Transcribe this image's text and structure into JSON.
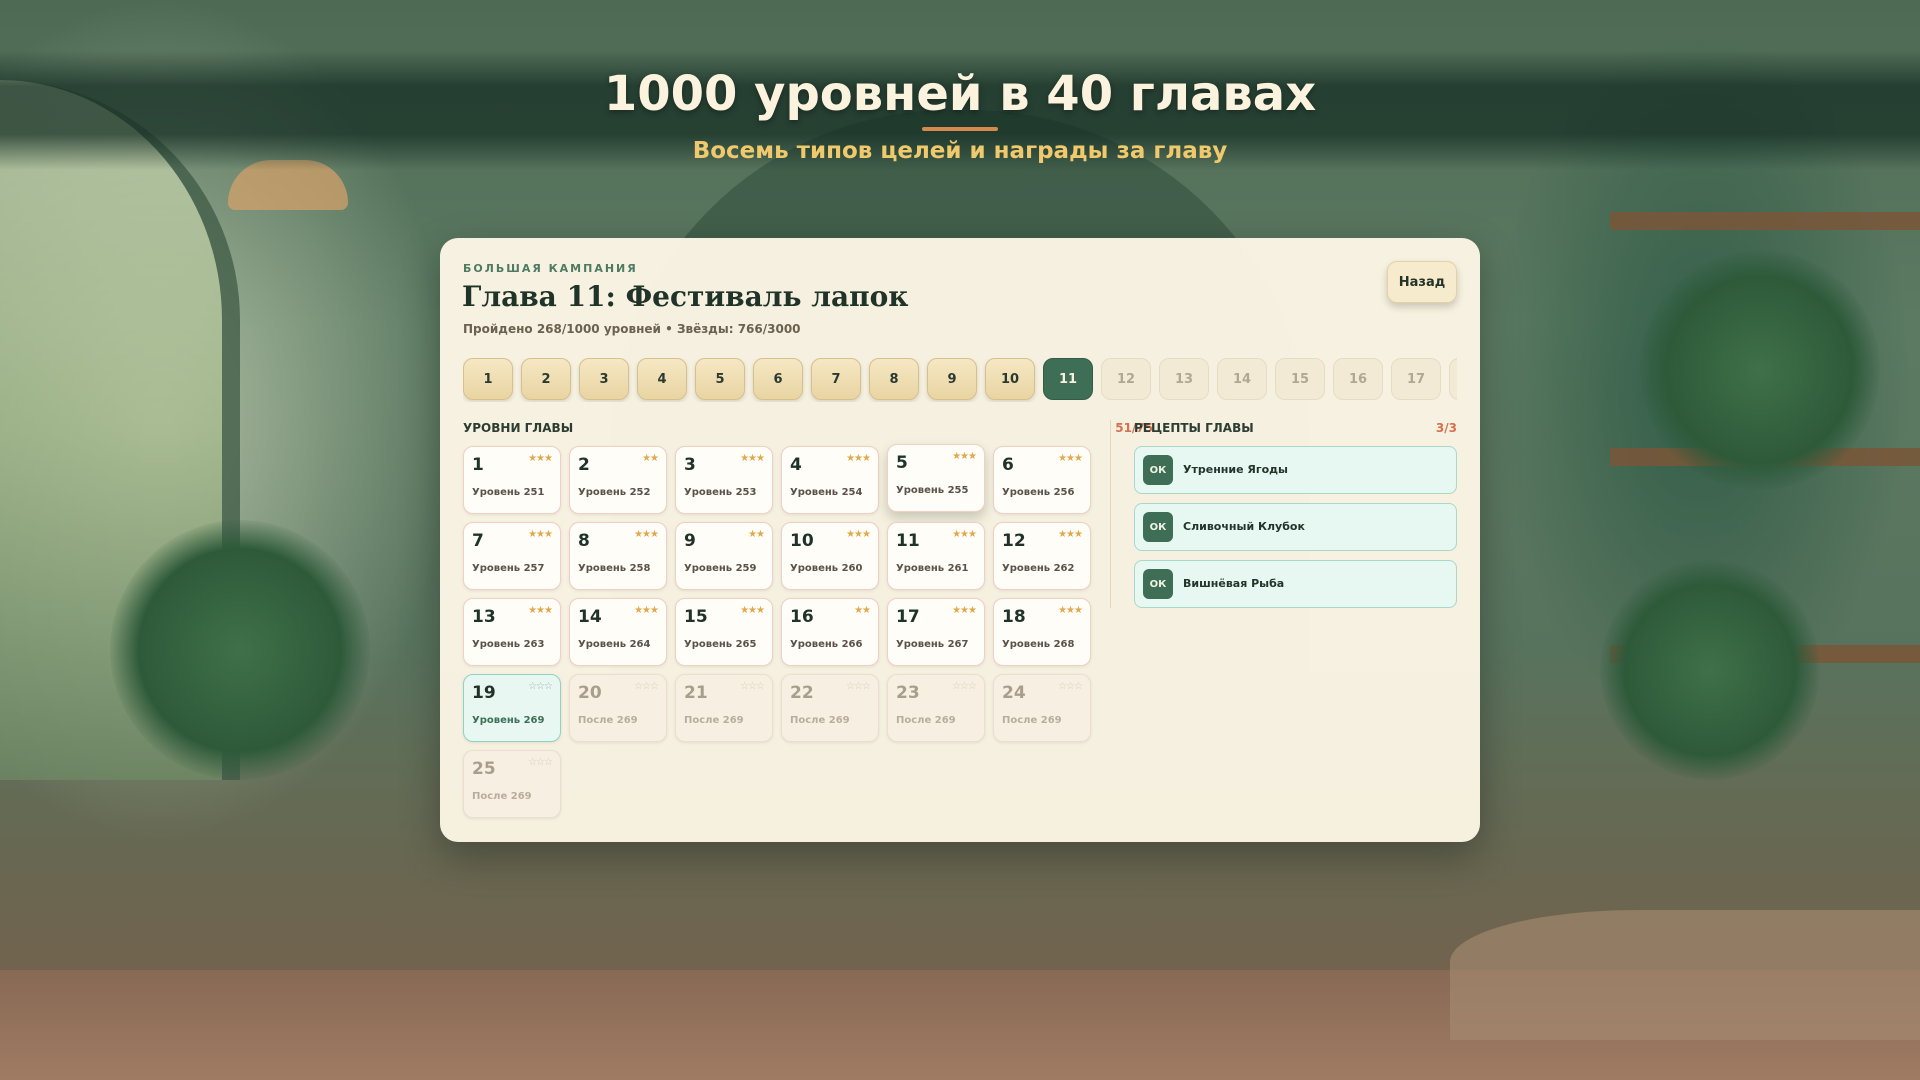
{
  "hero": {
    "title": "1000 уровней в 40 главах",
    "subtitle": "Восемь типов целей и награды за главу"
  },
  "panel": {
    "eyebrow": "БОЛЬШАЯ КАМПАНИЯ",
    "title": "Глава 11: Фестиваль лапок",
    "progress": "Пройдено 268/1000 уровней • Звёзды: 766/3000",
    "back_label": "Назад"
  },
  "chapters": {
    "visible": [
      {
        "label": "1",
        "state": "done"
      },
      {
        "label": "2",
        "state": "done"
      },
      {
        "label": "3",
        "state": "done"
      },
      {
        "label": "4",
        "state": "done"
      },
      {
        "label": "5",
        "state": "done"
      },
      {
        "label": "6",
        "state": "done"
      },
      {
        "label": "7",
        "state": "done"
      },
      {
        "label": "8",
        "state": "done"
      },
      {
        "label": "9",
        "state": "done"
      },
      {
        "label": "10",
        "state": "done"
      },
      {
        "label": "11",
        "state": "current"
      },
      {
        "label": "12",
        "state": "locked"
      },
      {
        "label": "13",
        "state": "locked"
      },
      {
        "label": "14",
        "state": "locked"
      },
      {
        "label": "15",
        "state": "locked"
      },
      {
        "label": "16",
        "state": "locked"
      },
      {
        "label": "17",
        "state": "locked"
      },
      {
        "label": "",
        "state": "locked"
      }
    ]
  },
  "levels": {
    "heading": "УРОВНИ ГЛАВЫ",
    "count": "51/75",
    "items": [
      {
        "num": "1",
        "sub": "Уровень 251",
        "stars": "★★★",
        "state": "done"
      },
      {
        "num": "2",
        "sub": "Уровень 252",
        "stars": "★★",
        "state": "done"
      },
      {
        "num": "3",
        "sub": "Уровень 253",
        "stars": "★★★",
        "state": "done"
      },
      {
        "num": "4",
        "sub": "Уровень 254",
        "stars": "★★★",
        "state": "done"
      },
      {
        "num": "5",
        "sub": "Уровень 255",
        "stars": "★★★",
        "state": "hover"
      },
      {
        "num": "6",
        "sub": "Уровень 256",
        "stars": "★★★",
        "state": "done"
      },
      {
        "num": "7",
        "sub": "Уровень 257",
        "stars": "★★★",
        "state": "done"
      },
      {
        "num": "8",
        "sub": "Уровень 258",
        "stars": "★★★",
        "state": "done"
      },
      {
        "num": "9",
        "sub": "Уровень 259",
        "stars": "★★",
        "state": "done"
      },
      {
        "num": "10",
        "sub": "Уровень 260",
        "stars": "★★★",
        "state": "done"
      },
      {
        "num": "11",
        "sub": "Уровень 261",
        "stars": "★★★",
        "state": "done"
      },
      {
        "num": "12",
        "sub": "Уровень 262",
        "stars": "★★★",
        "state": "done"
      },
      {
        "num": "13",
        "sub": "Уровень 263",
        "stars": "★★★",
        "state": "done"
      },
      {
        "num": "14",
        "sub": "Уровень 264",
        "stars": "★★★",
        "state": "done"
      },
      {
        "num": "15",
        "sub": "Уровень 265",
        "stars": "★★★",
        "state": "done"
      },
      {
        "num": "16",
        "sub": "Уровень 266",
        "stars": "★★",
        "state": "done"
      },
      {
        "num": "17",
        "sub": "Уровень 267",
        "stars": "★★★",
        "state": "done"
      },
      {
        "num": "18",
        "sub": "Уровень 268",
        "stars": "★★★",
        "state": "done"
      },
      {
        "num": "19",
        "sub": "Уровень 269",
        "stars": "☆☆☆",
        "state": "current"
      },
      {
        "num": "20",
        "sub": "После 269",
        "stars": "☆☆☆",
        "state": "locked"
      },
      {
        "num": "21",
        "sub": "После 269",
        "stars": "☆☆☆",
        "state": "locked"
      },
      {
        "num": "22",
        "sub": "После 269",
        "stars": "☆☆☆",
        "state": "locked"
      },
      {
        "num": "23",
        "sub": "После 269",
        "stars": "☆☆☆",
        "state": "locked"
      },
      {
        "num": "24",
        "sub": "После 269",
        "stars": "☆☆☆",
        "state": "locked"
      },
      {
        "num": "25",
        "sub": "После 269",
        "stars": "☆☆☆",
        "state": "locked"
      }
    ]
  },
  "recipes": {
    "heading": "РЕЦЕПТЫ ГЛАВЫ",
    "count": "3/3",
    "items": [
      {
        "badge": "ОК",
        "name": "Утренние Ягоды"
      },
      {
        "badge": "ОК",
        "name": "Сливочный Клубок"
      },
      {
        "badge": "ОК",
        "name": "Вишнёвая Рыба"
      }
    ]
  },
  "colors": {
    "accent_green": "#3f6e57",
    "accent_orange": "#d4714e",
    "star_gold": "#e0a94e",
    "hero_subtitle": "#f0c96c"
  }
}
